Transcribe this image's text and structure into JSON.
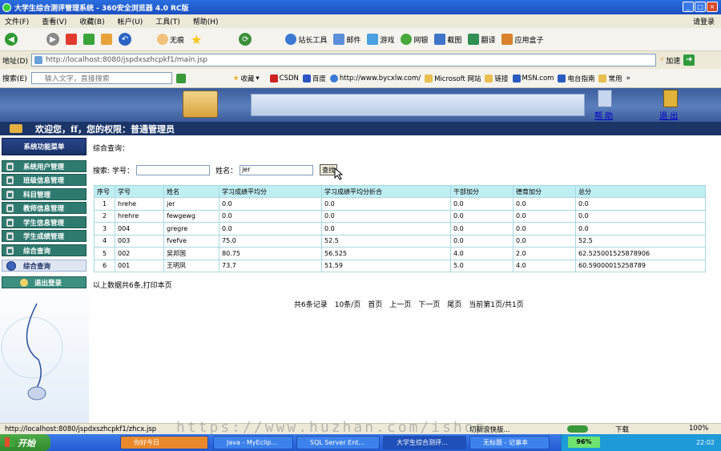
{
  "window": {
    "title": "大学生综合测评管理系统 - 360安全浏览器 4.0 RC版",
    "right_status": "请登录"
  },
  "menu": [
    "文件(F)",
    "查看(V)",
    "收藏(B)",
    "帐户(U)",
    "工具(T)",
    "帮助(H)"
  ],
  "toolbar": {
    "no_tab_label": "无痕",
    "site_tools": "站长工具",
    "mail": "邮件",
    "games": "游戏",
    "netbank": "网银",
    "screenshot": "截图",
    "translate": "翻译",
    "app_box": "应用盒子"
  },
  "address": {
    "label": "地址(D)",
    "url": "http://localhost:8080/jspdxszhcpkf1/main.jsp",
    "go_label": "加速"
  },
  "search": {
    "label": "搜索(E)",
    "placeholder": "输入文字，直接搜索"
  },
  "favorites": {
    "label": "收藏",
    "items": [
      "CSDN",
      "百度",
      "http://www.bycxlw.com/",
      "Microsoft 网站",
      "链接",
      "MSN.com",
      "电台指南",
      "常用"
    ]
  },
  "header": {
    "help": "帮 助",
    "logout": "退 出"
  },
  "welcome_text": "欢迎您，ff，您的权限：普通管理员",
  "sidebar": {
    "title": "系统功能菜单",
    "items": [
      "系统用户管理",
      "班级信息管理",
      "科目管理",
      "教师信息管理",
      "学生信息管理",
      "学生成绩管理",
      "综合查询",
      "综合查询",
      "退出登录"
    ]
  },
  "page": {
    "heading": "综合查询：",
    "search_label": "搜索:",
    "id_label": "学号：",
    "id_value": "",
    "name_label": "姓名：",
    "name_value": "jer",
    "search_button": "查找"
  },
  "table": {
    "headers": [
      "序号",
      "学号",
      "姓名",
      "学习成绩平均分",
      "学习成绩平均分折合",
      "干部加分",
      "德育加分",
      "总分"
    ],
    "rows": [
      [
        "1",
        "hrehe",
        "jer",
        "0.0",
        "0.0",
        "0.0",
        "0.0",
        "0.0"
      ],
      [
        "2",
        "hrehre",
        "fewgewg",
        "0.0",
        "0.0",
        "0.0",
        "0.0",
        "0.0"
      ],
      [
        "3",
        "004",
        "gregre",
        "0.0",
        "0.0",
        "0.0",
        "0.0",
        "0.0"
      ],
      [
        "4",
        "003",
        "fvefve",
        "75.0",
        "52.5",
        "0.0",
        "0.0",
        "52.5"
      ],
      [
        "5",
        "002",
        "吴邦国",
        "80.75",
        "56.525",
        "4.0",
        "2.0",
        "62.525001525878906"
      ],
      [
        "6",
        "001",
        "王明凤",
        "73.7",
        "51.59",
        "5.0",
        "4.0",
        "60.59000015258789"
      ]
    ]
  },
  "summary": "以上数据共6条,打印本页",
  "pagination": {
    "total": "共6条记录",
    "per_page": "10条/页",
    "first": "首页",
    "prev": "上一页",
    "next": "下一页",
    "last": "尾页",
    "current": "当前第1页/共1页"
  },
  "status": {
    "url": "http://localhost:8080/jspdxszhcpkf1/zhcx.jsp",
    "watermark": "https://www.huzhan.com/ishop",
    "mode": "切新浪快版...",
    "download": "下载",
    "zoom": "100%"
  },
  "taskbar": {
    "start": "开始",
    "tasks": [
      "你好今日",
      "Java - MyEclip...",
      "SQL Server Ent...",
      "大学生综合测评...",
      "无标题 - 记事本"
    ],
    "progress": "96%",
    "clock": "22:02"
  },
  "colors": {
    "title_bar": "#2a6fe0",
    "banner": "#4a6cab",
    "welcome_bar": "#1b3567",
    "sidebar_item": "#2e7a6f",
    "table_header": "#bfeef3",
    "taskbar": "#245ad2"
  }
}
